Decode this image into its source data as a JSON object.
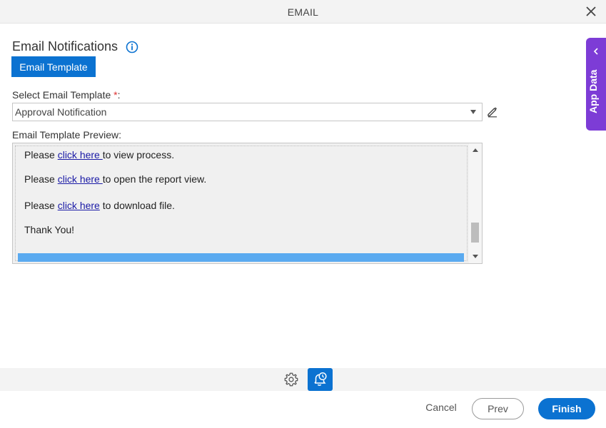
{
  "window": {
    "title": "EMAIL",
    "close_icon": "close-icon"
  },
  "header": {
    "title": "Email Notifications",
    "info_icon": "info-icon"
  },
  "tab": {
    "label": "Email Template"
  },
  "select_template": {
    "label": "Select Email Template",
    "required_mark": "*",
    "label_suffix": ":",
    "value": "Approval Notification",
    "edit_icon": "pencil-icon"
  },
  "preview": {
    "label": "Email Template Preview:",
    "lines": [
      {
        "prefix": "Please ",
        "link": "click here ",
        "suffix": "to view process."
      },
      {
        "prefix": "Please ",
        "link": "click here ",
        "suffix": "to open the report view."
      },
      {
        "prefix": "Please ",
        "link": "click here",
        "suffix": " to download file."
      }
    ],
    "closing": "Thank You!"
  },
  "side_panel": {
    "label": "App Data",
    "chevron_icon": "chevron-left-icon"
  },
  "bottom_toolbar": {
    "settings_icon": "gear-icon",
    "notification_icon": "bell-clock-icon"
  },
  "footer": {
    "cancel_label": "Cancel",
    "prev_label": "Prev",
    "finish_label": "Finish"
  },
  "colors": {
    "primary": "#0b72d1",
    "side_tab": "#7d3cd6",
    "required": "#d33333",
    "link": "#1a1aa6"
  }
}
